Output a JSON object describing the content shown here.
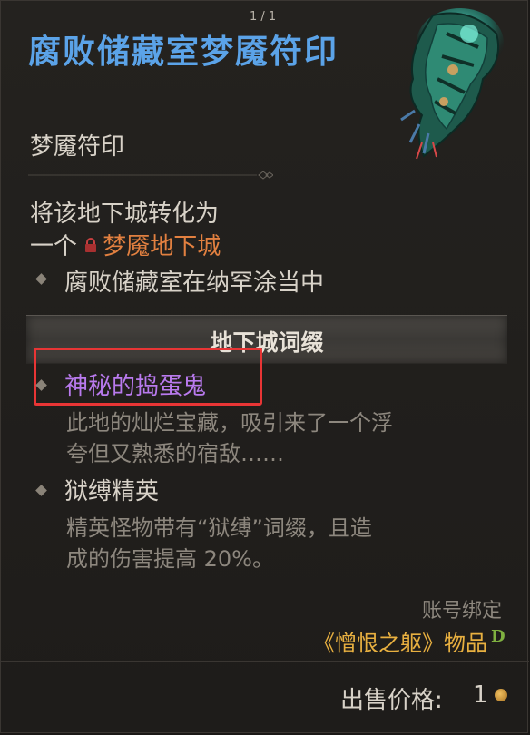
{
  "pager": "1 / 1",
  "item": {
    "title": "腐败储藏室梦魇符印",
    "type": "梦魇符印"
  },
  "description": {
    "line1": "将该地下城转化为",
    "prefix": "一个",
    "dungeon": "梦魇地下城",
    "location": "腐败储藏室在纳罕涂当中"
  },
  "affix_section": {
    "header": "地下城词缀",
    "affixes": [
      {
        "name": "神秘的捣蛋鬼",
        "desc_line1": "此地的灿烂宝藏，吸引来了一个浮",
        "desc_line2": "夸但又熟悉的宿敌……",
        "color": "#b97aee"
      },
      {
        "name": "狱缚精英",
        "desc_line1": "精英怪物带有“狱缚”词缀，且造",
        "desc_line2": "成的伤害提高 20%。",
        "color": "#d8d2c8"
      }
    ]
  },
  "footer": {
    "bound": "账号绑定",
    "origin": "《憎恨之躯》物品",
    "badge": "D",
    "sell_label": "出售价格:",
    "sell_value": "1"
  },
  "colors": {
    "title": "#5ba3e8",
    "dungeon": "#e28040",
    "highlight": "#e83535",
    "origin": "#e8b040"
  },
  "icons": [
    "lock-icon",
    "coin-icon",
    "bullet-icon",
    "sigil-image"
  ]
}
